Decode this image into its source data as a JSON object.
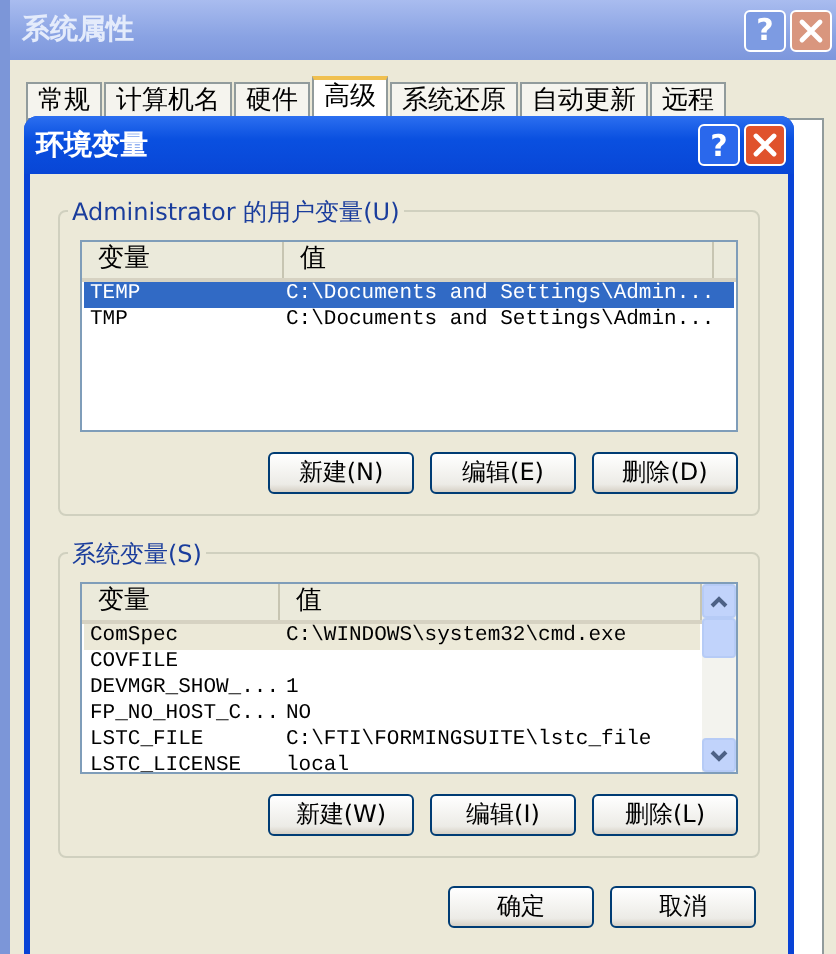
{
  "background_window": {
    "title": "系统属性",
    "help_button": "?",
    "tabs": [
      {
        "label": "常规",
        "selected": false
      },
      {
        "label": "计算机名",
        "selected": false
      },
      {
        "label": "硬件",
        "selected": false
      },
      {
        "label": "高级",
        "selected": true
      },
      {
        "label": "系统还原",
        "selected": false
      },
      {
        "label": "自动更新",
        "selected": false
      },
      {
        "label": "远程",
        "selected": false
      }
    ]
  },
  "dialog": {
    "title": "环境变量",
    "help_button": "?",
    "user_group": {
      "label": "Administrator 的用户变量(U)",
      "columns": [
        "变量",
        "值"
      ],
      "scrollbar": false,
      "rows": [
        {
          "name": "TEMP",
          "value": "C:\\Documents and Settings\\Admin...",
          "selected": true
        },
        {
          "name": "TMP",
          "value": "C:\\Documents and Settings\\Admin...",
          "selected": false
        }
      ],
      "buttons": [
        "新建(N)",
        "编辑(E)",
        "删除(D)"
      ]
    },
    "system_group": {
      "label": "系统变量(S)",
      "columns": [
        "变量",
        "值"
      ],
      "scrollbar": true,
      "rows": [
        {
          "name": "ComSpec",
          "value": "C:\\WINDOWS\\system32\\cmd.exe",
          "selected": true
        },
        {
          "name": "COVFILE",
          "value": "",
          "selected": false
        },
        {
          "name": "DEVMGR_SHOW_...",
          "value": "1",
          "selected": false
        },
        {
          "name": "FP_NO_HOST_C...",
          "value": "NO",
          "selected": false
        },
        {
          "name": "LSTC_FILE",
          "value": "C:\\FTI\\FORMINGSUITE\\lstc_file",
          "selected": false
        },
        {
          "name": "LSTC_LICENSE",
          "value": "local",
          "selected": false
        }
      ],
      "buttons": [
        "新建(W)",
        "编辑(I)",
        "删除(L)"
      ]
    },
    "buttons": [
      "确定",
      "取消"
    ]
  }
}
